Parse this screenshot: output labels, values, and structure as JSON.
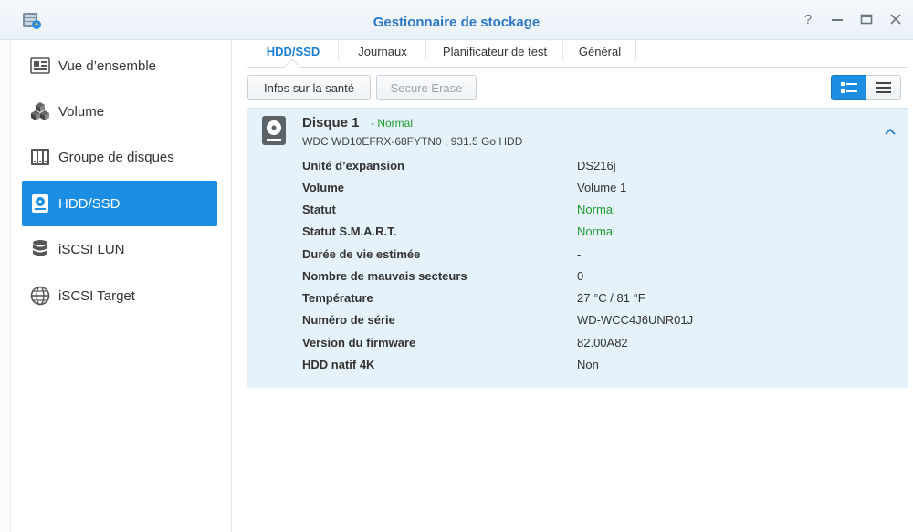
{
  "window": {
    "title": "Gestionnaire de stockage",
    "controls": [
      "help-icon",
      "minimize-icon",
      "maximize-icon",
      "close-icon"
    ]
  },
  "sidebar": {
    "items": [
      {
        "label": "Vue d’ensemble",
        "icon": "overview-icon",
        "active": false
      },
      {
        "label": "Volume",
        "icon": "volume-cubes-icon",
        "active": false
      },
      {
        "label": "Groupe de disques",
        "icon": "disk-group-icon",
        "active": false
      },
      {
        "label": "HDD/SSD",
        "icon": "hdd-icon",
        "active": true
      },
      {
        "label": "iSCSI LUN",
        "icon": "database-icon",
        "active": false
      },
      {
        "label": "iSCSI Target",
        "icon": "globe-icon",
        "active": false
      }
    ]
  },
  "tabs": [
    {
      "label": "HDD/SSD",
      "active": true
    },
    {
      "label": "Journaux",
      "active": false
    },
    {
      "label": "Planificateur de test",
      "active": false
    },
    {
      "label": "Général",
      "active": false
    }
  ],
  "toolbar": {
    "health_label": "Infos sur la santé",
    "secure_erase_label": "Secure Erase",
    "view_modes": [
      "detail-view-icon",
      "list-view-icon"
    ]
  },
  "disk": {
    "name": "Disque 1",
    "status": "- Normal",
    "model": "WDC WD10EFRX-68FYTN0 , 931.5 Go HDD",
    "details": [
      {
        "label": "Unité d’expansion",
        "value": "DS216j"
      },
      {
        "label": "Volume",
        "value": "Volume 1"
      },
      {
        "label": "Statut",
        "value": "Normal",
        "color": "#1e9a2e"
      },
      {
        "label": "Statut S.M.A.R.T.",
        "value": "Normal",
        "color": "#1e9a2e"
      },
      {
        "label": "Durée de vie estimée",
        "value": "-"
      },
      {
        "label": "Nombre de mauvais secteurs",
        "value": "0"
      },
      {
        "label": "Température",
        "value": "27 °C / 81 °F"
      },
      {
        "label": "Numéro de série",
        "value": "WD-WCC4J6UNR01J"
      },
      {
        "label": "Version du firmware",
        "value": "82.00A82"
      },
      {
        "label": "HDD natif 4K",
        "value": "Non"
      }
    ]
  },
  "colors": {
    "accent": "#1b8de2",
    "title": "#2b78c5",
    "ok": "#1e9a2e",
    "panel": "#e6f2fb"
  }
}
